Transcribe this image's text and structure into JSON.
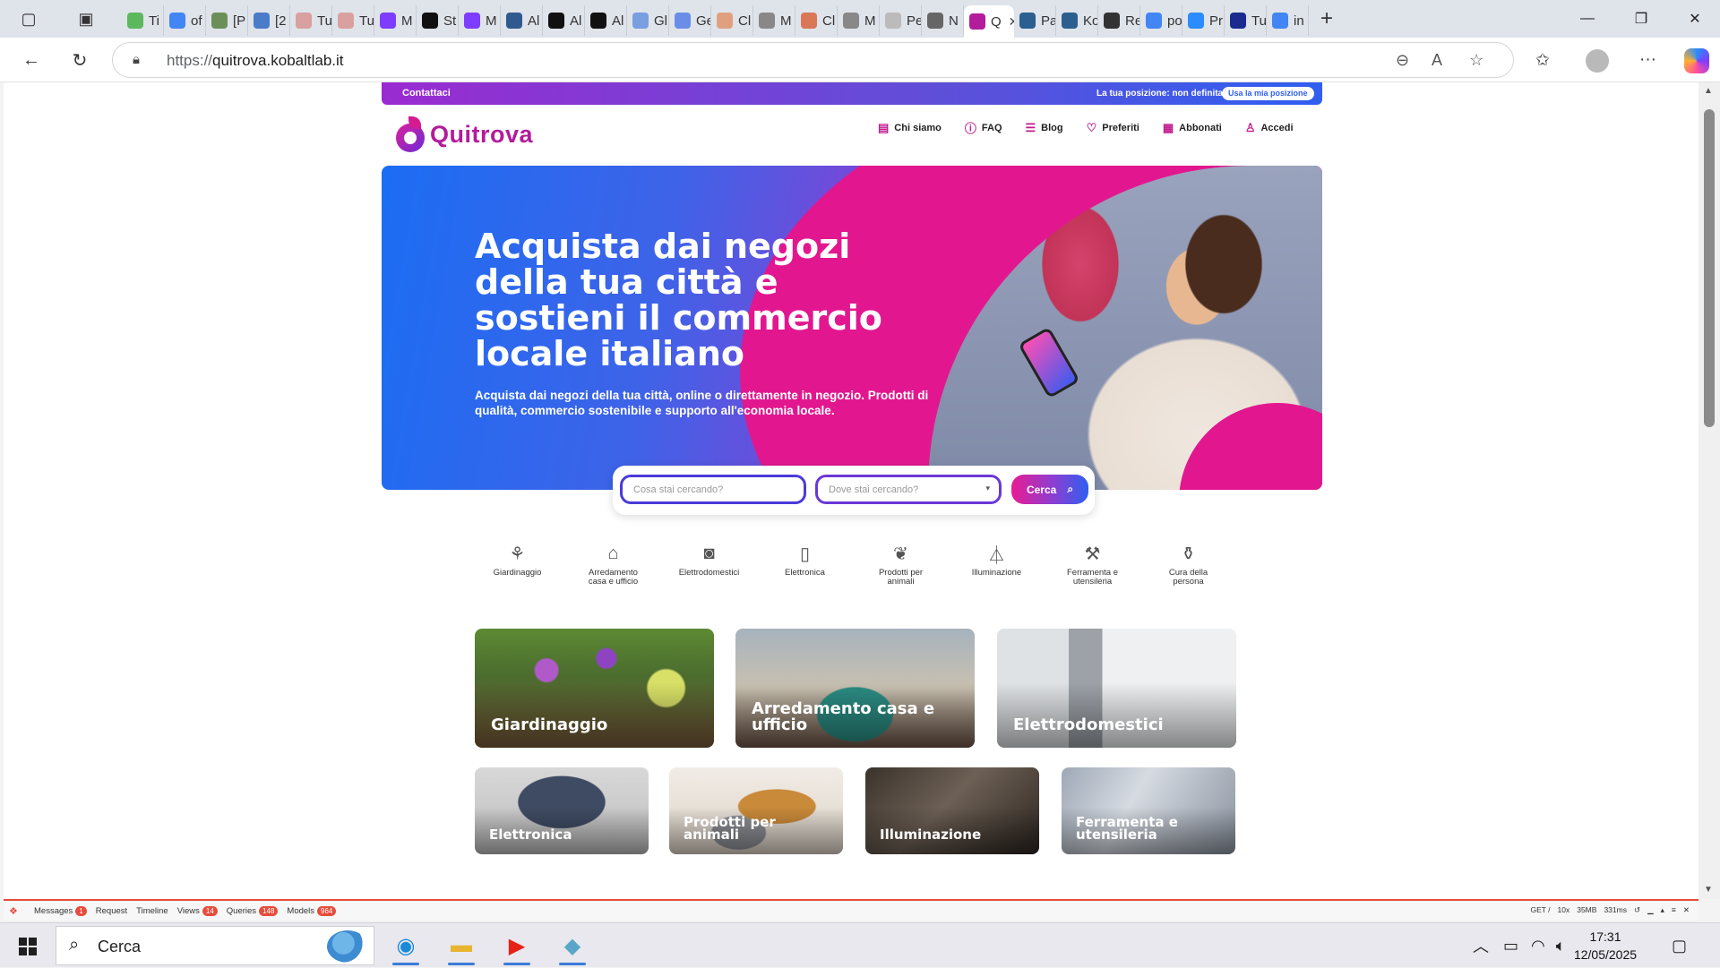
{
  "browser": {
    "tabs": [
      {
        "label": "Ti",
        "color": "#5cb85c"
      },
      {
        "label": "of",
        "color": "#4285f4"
      },
      {
        "label": "[P",
        "color": "#6c8f5a"
      },
      {
        "label": "[2",
        "color": "#4a7cc9"
      },
      {
        "label": "Tu",
        "color": "#d9a0a0"
      },
      {
        "label": "Tu",
        "color": "#d9a0a0"
      },
      {
        "label": "M",
        "color": "#7d3cff"
      },
      {
        "label": "St",
        "color": "#111111"
      },
      {
        "label": "M",
        "color": "#7d3cff"
      },
      {
        "label": "Al",
        "color": "#2f5a8f"
      },
      {
        "label": "Al",
        "color": "#111111"
      },
      {
        "label": "Al",
        "color": "#111111"
      },
      {
        "label": "Gl",
        "color": "#7a9fe0"
      },
      {
        "label": "Ge",
        "color": "#6a8ee8"
      },
      {
        "label": "Cl",
        "color": "#e0a080"
      },
      {
        "label": "M",
        "color": "#888888"
      },
      {
        "label": "Cl",
        "color": "#d97757"
      },
      {
        "label": "M",
        "color": "#888888"
      },
      {
        "label": "Pe",
        "color": "#bbbbbb"
      },
      {
        "label": "N",
        "color": "#666666"
      },
      {
        "label": "Q",
        "color": "#b31c9a",
        "active": true
      },
      {
        "label": "Pa",
        "color": "#2a5f8f"
      },
      {
        "label": "Ko",
        "color": "#2a5f8f"
      },
      {
        "label": "Re",
        "color": "#333333"
      },
      {
        "label": "po",
        "color": "#4285f4"
      },
      {
        "label": "Pr",
        "color": "#2a8cff"
      },
      {
        "label": "Tu",
        "color": "#1a2a8f"
      },
      {
        "label": "in",
        "color": "#4285f4"
      }
    ],
    "url_scheme": "https://",
    "url_host": "quitrova.kobaltlab.it"
  },
  "site": {
    "topbar": {
      "contact": "Contattaci",
      "position_text": "La tua posizione: non definita",
      "position_button": "Usa la mia posizione"
    },
    "logo_text": "Quitrova",
    "nav": [
      {
        "label": "Chi siamo",
        "icon": "document-icon"
      },
      {
        "label": "FAQ",
        "icon": "help-icon"
      },
      {
        "label": "Blog",
        "icon": "list-icon"
      },
      {
        "label": "Preferiti",
        "icon": "heart-icon"
      },
      {
        "label": "Abbonati",
        "icon": "gift-icon"
      },
      {
        "label": "Accedi",
        "icon": "user-icon"
      }
    ],
    "hero": {
      "title": "Acquista dai negozi della tua città e sostieni il commercio locale italiano",
      "subtitle": "Acquista dai negozi della tua città, online o direttamente in negozio. Prodotti di qualità, commercio sostenibile e supporto all'economia locale."
    },
    "search": {
      "what_placeholder": "Cosa stai cercando?",
      "where_placeholder": "Dove stai cercando?",
      "button": "Cerca"
    },
    "categories": [
      {
        "label": "Giardinaggio",
        "icon": "plant-icon"
      },
      {
        "label": "Arredamento casa e ufficio",
        "icon": "furniture-icon"
      },
      {
        "label": "Elettrodomestici",
        "icon": "washing-machine-icon"
      },
      {
        "label": "Elettronica",
        "icon": "smartphone-icon"
      },
      {
        "label": "Prodotti per animali",
        "icon": "pet-icon"
      },
      {
        "label": "Illuminazione",
        "icon": "lamp-icon"
      },
      {
        "label": "Ferramenta e utensileria",
        "icon": "tools-icon"
      },
      {
        "label": "Cura della persona",
        "icon": "bottles-icon"
      }
    ],
    "tiles_large": [
      {
        "title": "Giardinaggio"
      },
      {
        "title": "Arredamento casa e ufficio"
      },
      {
        "title": "Elettrodomestici"
      }
    ],
    "tiles_small": [
      {
        "title": "Elettronica"
      },
      {
        "title": "Prodotti per animali"
      },
      {
        "title": "Illuminazione"
      },
      {
        "title": "Ferramenta e utensileria"
      }
    ]
  },
  "debugbar": {
    "items": [
      {
        "label": "Messages",
        "badge": "1"
      },
      {
        "label": "Request",
        "badge": ""
      },
      {
        "label": "Timeline",
        "badge": ""
      },
      {
        "label": "Views",
        "badge": "14"
      },
      {
        "label": "Queries",
        "badge": "148"
      },
      {
        "label": "Models",
        "badge": "964"
      }
    ],
    "method": "GET /",
    "time_a": "10x",
    "memory": "35MB",
    "duration": "331ms"
  },
  "taskbar": {
    "search_text": "Cerca",
    "time": "17:31",
    "date": "12/05/2025"
  }
}
